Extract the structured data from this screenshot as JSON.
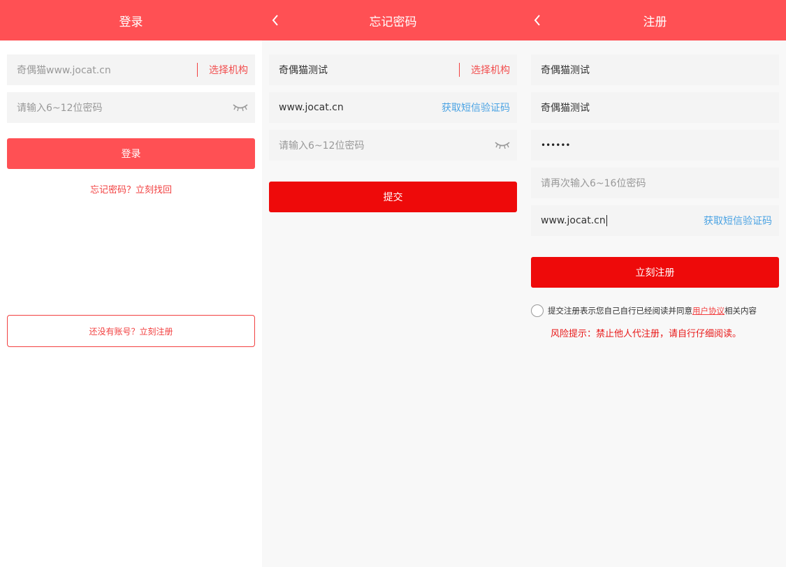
{
  "login": {
    "title": "登录",
    "institution_placeholder": "奇偶猫www.jocat.cn",
    "choose_org": "选择机构",
    "password_placeholder": "请输入6~12位密码",
    "login_button": "登录",
    "forgot_link": "忘记密码？立刻找回",
    "register_button": "还没有账号？立刻注册"
  },
  "forgot": {
    "title": "忘记密码",
    "institution_value": "奇偶猫测试",
    "choose_org": "选择机构",
    "phone_value": "www.jocat.cn",
    "sms_code": "获取短信验证码",
    "password_placeholder": "请输入6~12位密码",
    "submit_button": "提交"
  },
  "register": {
    "title": "注册",
    "field1_value": "奇偶猫测试",
    "field2_value": "奇偶猫测试",
    "password_dots": "••••••",
    "confirm_placeholder": "请再次输入6~16位密码",
    "phone_value": "www.jocat.cn",
    "sms_code": "获取短信验证码",
    "register_button": "立刻注册",
    "agree_prefix": "提交注册表示您自己自行已经阅读并同意",
    "agreement_link": "用户协议",
    "agree_suffix": "相关内容",
    "risk_notice": "风险提示：禁止他人代注册，请自行仔细阅读。"
  },
  "icons": {
    "back": "chevron-left-icon",
    "eye": "eye-closed-icon",
    "radio": "radio-unchecked-icon"
  },
  "colors": {
    "header": "#ff5054",
    "primary_button": "#ee0a0a",
    "link_red": "#f24040",
    "link_blue": "#4ba3e3"
  }
}
